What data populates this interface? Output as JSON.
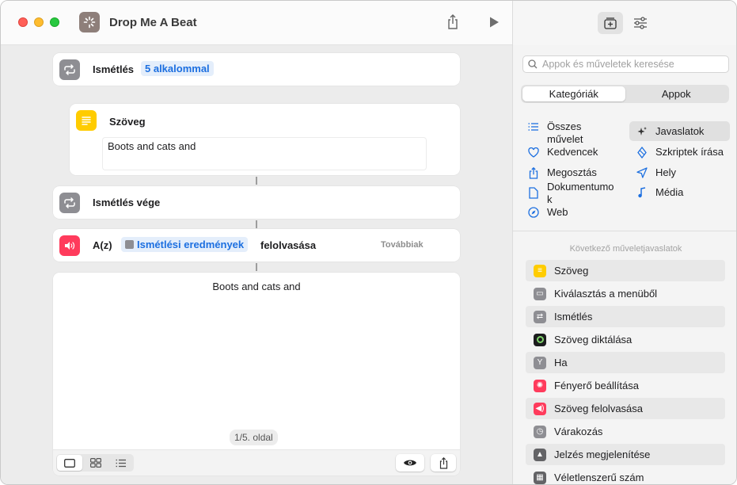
{
  "window": {
    "title": "Drop Me A Beat"
  },
  "workflow": {
    "repeat": {
      "label": "Ismétlés",
      "count": "5 alkalommal"
    },
    "text_action": {
      "label": "Szöveg",
      "value": "Boots and cats and"
    },
    "end_repeat": {
      "label": "Ismétlés vége"
    },
    "speak": {
      "prefix": "A(z)",
      "variable": "Ismétlési eredmények",
      "suffix": "felolvasása",
      "more": "Továbbiak"
    },
    "preview": {
      "text": "Boots and cats and",
      "page": "1/5. oldal"
    }
  },
  "sidebar": {
    "search_placeholder": "Appok és műveletek keresése",
    "tabs": [
      "Kategóriák",
      "Appok"
    ],
    "categories_left": [
      "Összes művelet",
      "Kedvencek",
      "Megosztás",
      "Dokumentumok",
      "Web"
    ],
    "categories_right": [
      "Javaslatok",
      "Szkriptek írása",
      "Hely",
      "Média"
    ],
    "suggestions_title": "Következő műveletjavaslatok",
    "suggestions": [
      {
        "label": "Szöveg",
        "color": "#ffcc00"
      },
      {
        "label": "Kiválasztás a menüből",
        "color": "#8e8e93"
      },
      {
        "label": "Ismétlés",
        "color": "#8e8e93"
      },
      {
        "label": "Szöveg diktálása",
        "color": "#1c1c1e"
      },
      {
        "label": "Ha",
        "color": "#8e8e93"
      },
      {
        "label": "Fényerő beállítása",
        "color": "#ff3b5c"
      },
      {
        "label": "Szöveg felolvasása",
        "color": "#ff3b5c"
      },
      {
        "label": "Várakozás",
        "color": "#8e8e93"
      },
      {
        "label": "Jelzés megjelenítése",
        "color": "#636366"
      },
      {
        "label": "Véletlenszerű szám",
        "color": "#636366"
      }
    ]
  }
}
